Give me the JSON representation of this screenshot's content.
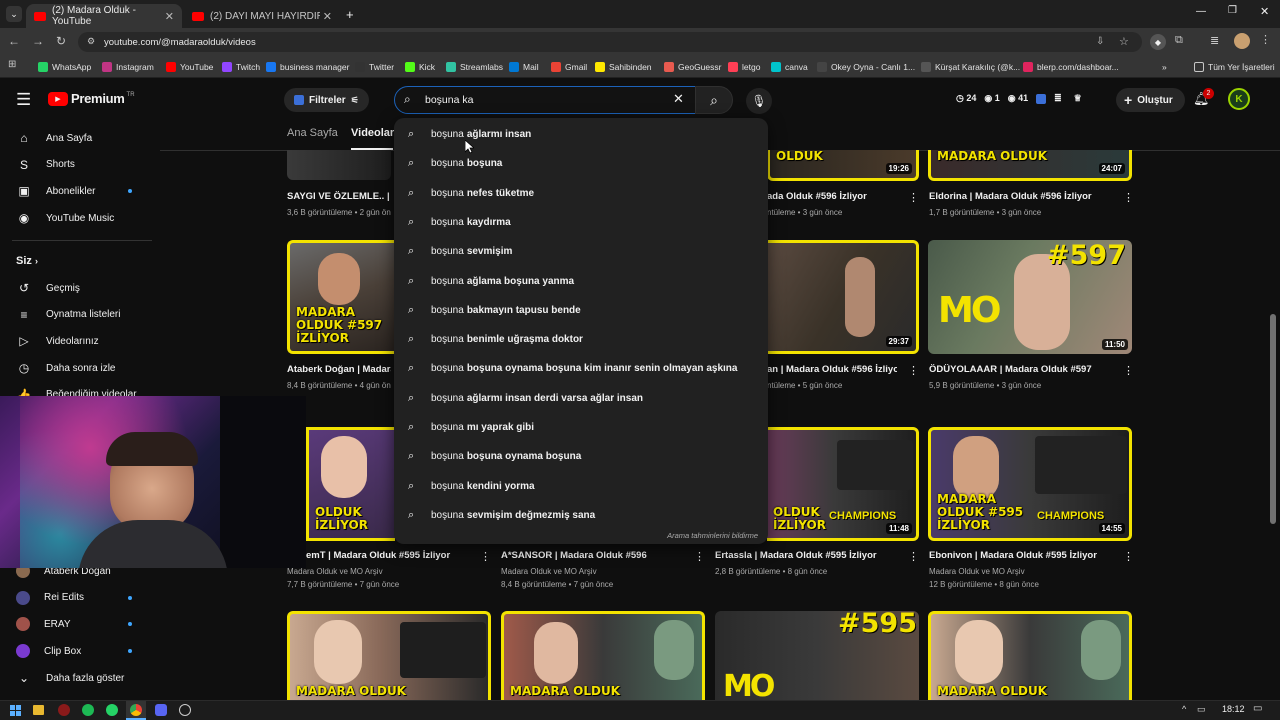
{
  "browser": {
    "tabs": [
      {
        "title": "(2) Madara Olduk - YouTube",
        "active": true
      },
      {
        "title": "(2) DAYI MAYI HAYIRDIR! Türkiy",
        "active": false
      }
    ],
    "url": "youtube.com/@madaraolduk/videos",
    "bookmarks": [
      {
        "label": "WhatsApp",
        "color": "#25d366"
      },
      {
        "label": "Instagram",
        "color": "#c13584"
      },
      {
        "label": "YouTube",
        "color": "#ff0000"
      },
      {
        "label": "Twitch",
        "color": "#9146ff"
      },
      {
        "label": "business manager",
        "color": "#1877f2"
      },
      {
        "label": "Twitter",
        "color": "#333333"
      },
      {
        "label": "Kick",
        "color": "#53fc18"
      },
      {
        "label": "Streamlabs",
        "color": "#31c3a2"
      },
      {
        "label": "Mail",
        "color": "#0078d4"
      },
      {
        "label": "Gmail",
        "color": "#ea4335"
      },
      {
        "label": "Sahibinden",
        "color": "#ffe800"
      },
      {
        "label": "GeoGuessr",
        "color": "#e85a4f"
      },
      {
        "label": "letgo",
        "color": "#ff3f55"
      },
      {
        "label": "canva",
        "color": "#00c4cc"
      },
      {
        "label": "Okey Oyna - Canlı 1...",
        "color": "#444444"
      },
      {
        "label": "Kürşat Karakılıç (@k...",
        "color": "#555555"
      },
      {
        "label": "blerp.com/dashboar...",
        "color": "#e0245e"
      }
    ],
    "all_bookmarks": "Tüm Yer İşaretleri"
  },
  "yt": {
    "logo": "Premium",
    "region": "TR",
    "filters": "Filtreler",
    "search_value": "boşuna ka",
    "stats": {
      "a": "24",
      "b": "1",
      "c": "41"
    },
    "create": "Oluştur",
    "notif_count": "2",
    "avatar_letter": "K"
  },
  "sidebar": {
    "main": [
      {
        "label": "Ana Sayfa",
        "icon": "home-icon",
        "glyph": "⌂"
      },
      {
        "label": "Shorts",
        "icon": "shorts-icon",
        "glyph": "S"
      },
      {
        "label": "Abonelikler",
        "icon": "subscriptions-icon",
        "glyph": "▣",
        "dot": true
      },
      {
        "label": "YouTube Music",
        "icon": "music-icon",
        "glyph": "◉"
      }
    ],
    "you_header": "Siz",
    "you": [
      {
        "label": "Geçmiş",
        "icon": "history-icon",
        "glyph": "↺"
      },
      {
        "label": "Oynatma listeleri",
        "icon": "playlists-icon",
        "glyph": "≡"
      },
      {
        "label": "Videolarınız",
        "icon": "your-videos-icon",
        "glyph": "▷"
      },
      {
        "label": "Daha sonra izle",
        "icon": "watch-later-icon",
        "glyph": "◷"
      },
      {
        "label": "Beğendiğim videolar",
        "icon": "liked-icon",
        "glyph": "👍"
      }
    ],
    "subs": [
      {
        "label": "Ataberk Doğan",
        "color": "#8a6a50"
      },
      {
        "label": "Rei Edits",
        "color": "#4a4a8a",
        "dot": true
      },
      {
        "label": "ERAY",
        "color": "#a0524a",
        "dot": true
      },
      {
        "label": "Clip Box",
        "color": "#7a3ad0",
        "dot": true
      }
    ],
    "more": "Daha fazla göster"
  },
  "channel_tabs": {
    "home": "Ana Sayfa",
    "videos": "Videolar"
  },
  "videos_row0": [
    {
      "title": "SAYGI VE ÖZLEMLE.. | Ma",
      "meta": "3,6 B görüntüleme • 2 gün önc"
    },
    {
      "title": "ada Olduk #596 İzliyor",
      "meta": "ntüleme • 3 gün önce",
      "dur": "19:26"
    },
    {
      "title": "Eldorina | Madara Olduk #596 İzliyor",
      "meta": "1,7 B görüntüleme • 3 gün önce",
      "dur": "24:07"
    }
  ],
  "videos_row1": [
    {
      "title": "Ataberk Doğan | Madara O",
      "meta": "8,4 B görüntüleme • 4 gün önc",
      "thumb_text": "MADARA OLDUK #597 İZLİYOR"
    },
    {
      "title": "an | Madara Olduk #596 İzliyor",
      "meta": "ntüleme • 5 gün önce",
      "dur": "29:37"
    },
    {
      "title": "ÖDÜYOLAAAR | Madara Olduk #597",
      "meta": "5,9 B görüntüleme • 3 gün önce",
      "dur": "11:50",
      "thumb_text": "#597"
    }
  ],
  "videos_row2": [
    {
      "title": "emT | Madara Olduk #595 İzliyor",
      "channel": "Madara Olduk ve MO Arşiv",
      "meta": "7,7 B görüntüleme • 7 gün önce",
      "thumb_text": "OLDUK İZLİYOR"
    },
    {
      "title": "A*SANSOR | Madara Olduk #596",
      "channel": "Madara Olduk ve MO Arşiv",
      "meta": "8,4 B görüntüleme • 7 gün önce"
    },
    {
      "title": "Ertassla | Madara Olduk #595 İzliyor",
      "channel": "",
      "meta": "2,8 B görüntüleme • 8 gün önce",
      "dur": "11:48",
      "thumb_text": "OLDUK İZLİYOR"
    },
    {
      "title": "Ebonivon | Madara Olduk #595 İzliyor",
      "channel": "Madara Olduk ve MO Arşiv",
      "meta": "12 B görüntüleme • 8 gün önce",
      "dur": "14:55",
      "thumb_text": "MADARA OLDUK #595 İZLİYOR"
    }
  ],
  "row3_thumb_text": [
    "MADARA OLDUK",
    "MADARA OLDUK",
    "#595",
    "MADARA OLDUK"
  ],
  "suggestions": {
    "prefix": "boşuna",
    "items": [
      "ağlarmı insan",
      "boşuna",
      "nefes tüketme",
      "kaydırma",
      "sevmişim",
      "ağlama boşuna yanma",
      "bakmayın tapusu bende",
      "benimle uğraşma doktor",
      "boşuna oynama boşuna kim inanır senin olmayan aşkına",
      "ağlarmı insan derdi varsa ağlar insan",
      "mı yaprak gibi",
      "boşuna oynama boşuna",
      "kendini yorma",
      "sevmişim değmezmiş sana"
    ],
    "report": "Arama tahminlerini bildirme"
  },
  "taskbar": {
    "time": "18:12"
  },
  "colors": {
    "accent": "#f3e300",
    "brand": "#ff0000",
    "link": "#3ea6ff"
  }
}
